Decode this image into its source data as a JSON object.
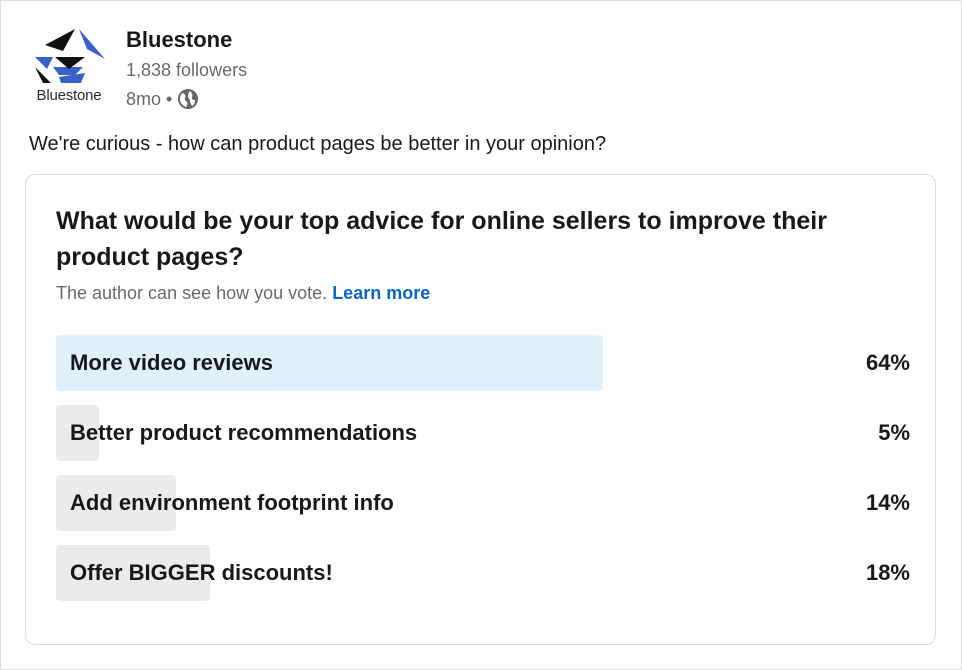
{
  "company": {
    "name": "Bluestone",
    "logo_text": "Bluestone",
    "followers": "1,838 followers",
    "age": "8mo",
    "separator": "•",
    "visibility_icon": "globe-icon"
  },
  "post": {
    "text": "We're curious - how can product pages be better in your opinion?"
  },
  "poll": {
    "question": "What would be your top advice for online sellers to improve their product pages?",
    "note": "The author can see how you vote.",
    "learn_more": "Learn more",
    "options": [
      {
        "label": "More video reviews",
        "percent_text": "64%",
        "percent": 64,
        "selected": true
      },
      {
        "label": "Better product recommendations",
        "percent_text": "5%",
        "percent": 5,
        "selected": false
      },
      {
        "label": "Add environment footprint info",
        "percent_text": "14%",
        "percent": 14,
        "selected": false
      },
      {
        "label": "Offer BIGGER discounts!",
        "percent_text": "18%",
        "percent": 18,
        "selected": false
      }
    ]
  },
  "colors": {
    "brand_blue": "#3a5fc8",
    "brand_dark": "#111111",
    "link": "#0a66c2",
    "selected_fill": "#e2f0fe",
    "option_fill": "#ebebeb"
  }
}
